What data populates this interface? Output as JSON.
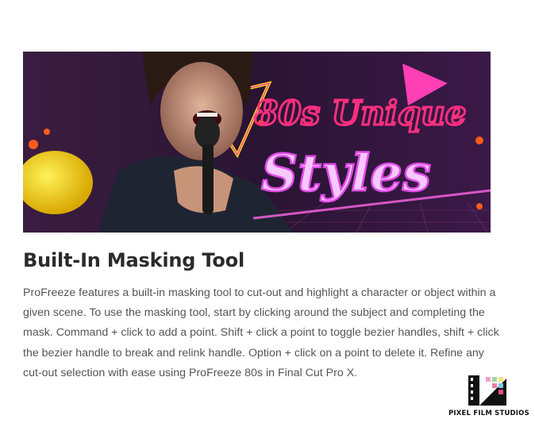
{
  "hero": {
    "overlay_line1": "80s Unique",
    "overlay_line2": "Styles",
    "icon": "retro-video-frame"
  },
  "section": {
    "title": "Built-In Masking Tool",
    "description": "ProFreeze features a built-in masking tool to cut-out and highlight a character or object within a given scene. To use the masking tool, start by clicking around the subject and completing the mask. Command + click to add a point. Shift + click a point to toggle bezier handles, shift + click the bezier handle to break and relink handle. Option + click on a point to delete it. Refine any cut-out selection with ease using ProFreeze 80s in Final Cut Pro X."
  },
  "brand": {
    "name": "PIXEL FILM STUDIOS",
    "logo_icon": "film-strip-logo",
    "colors": {
      "text": "#2b2b2b",
      "body": "#555555",
      "neon_pink": "#ff3fb4",
      "neon_yellow": "#ffe400"
    }
  }
}
